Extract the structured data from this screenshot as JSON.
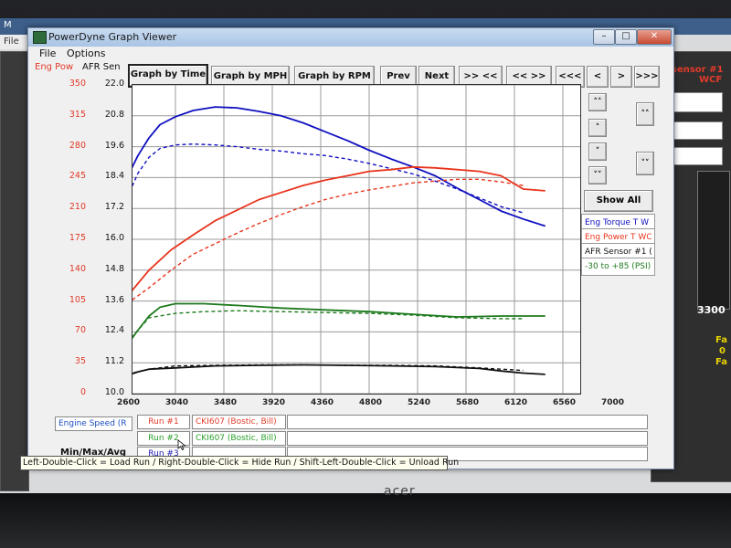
{
  "window": {
    "title": "PowerDyne Graph Viewer",
    "menu": [
      "File",
      "Options"
    ]
  },
  "background_app": {
    "title_fragment": "M",
    "menu_file": "File",
    "sensor_label": "sensor #1",
    "sensor_sub": "WCF",
    "rpm_readout": "3300",
    "fa1": "Fa",
    "fa2": "0",
    "fa3": "Fa"
  },
  "axis_headers": {
    "power": "Eng Pow",
    "afr": "AFR Sen"
  },
  "toolbar": {
    "graph_by_time": "Graph by Time",
    "graph_by_mph": "Graph by MPH",
    "graph_by_rpm": "Graph by RPM",
    "prev": "Prev",
    "next": "Next",
    "zoom_in": ">> <<",
    "zoom_out": "<< >>",
    "first": "<<<",
    "left": "<",
    "right": ">",
    "last": ">>>"
  },
  "side_buttons": {
    "up_fast": "˄˄",
    "up": "˄",
    "down": "˅",
    "down_fast": "˅˅",
    "right_up": "˄˄",
    "right_down": "˅˅",
    "show_all": "Show All"
  },
  "legend": {
    "torque": "Eng Torque T W",
    "power": "Eng Power T WC",
    "afr": "AFR Sensor #1 (",
    "boost": "-30 to +85 (PSI)"
  },
  "bottom": {
    "x_channel": "Engine Speed (R",
    "min_max": "Min/Max/Avg",
    "runs": [
      {
        "label": "Run #1",
        "name": "CKI607 (Bostic, Bill)"
      },
      {
        "label": "Run #2",
        "name": "CKI607 (Bostic, Bill)"
      },
      {
        "label": "Run #3",
        "name": ""
      }
    ]
  },
  "tooltip": "Left-Double-Click = Load Run  /  Right-Double-Click = Hide Run  /  Shift-Left-Double-Click = Unload Run",
  "brand": "acer",
  "colors": {
    "torque": "#1010c0",
    "power": "#e8341c",
    "boost": "#1e7a1e",
    "afr": "#111111",
    "power_axis": "#e23b2a",
    "run2": "#2aa02a",
    "run3": "#1b1bb0"
  },
  "chart_data": {
    "type": "line",
    "x_ticks": [
      2600,
      3040,
      3480,
      3920,
      4360,
      4800,
      5240,
      5680,
      6120,
      6560,
      7000
    ],
    "xlim": [
      2600,
      7000
    ],
    "y_left_ticks": [
      0,
      35,
      70,
      105,
      140,
      175,
      210,
      245,
      280,
      315,
      350
    ],
    "ylim_left": [
      0,
      350
    ],
    "y_afr_ticks": [
      "10.0",
      "11.2",
      "12.4",
      "13.6",
      "14.8",
      "16.0",
      "17.2",
      "18.4",
      "19.6",
      "20.8",
      "22.0"
    ],
    "ylim_afr": [
      10.0,
      22.0
    ],
    "series": [
      {
        "key": "torque_run1",
        "color": "#1010c0",
        "dash": false,
        "x": [
          2600,
          2700,
          2800,
          2900,
          3040,
          3200,
          3400,
          3600,
          3800,
          4000,
          4200,
          4400,
          4600,
          4800,
          5000,
          5200,
          5400,
          5600,
          5800,
          6000,
          6200,
          6400
        ],
        "y": [
          245,
          270,
          290,
          305,
          314,
          321,
          325,
          324,
          320,
          315,
          307,
          297,
          287,
          276,
          266,
          257,
          247,
          233,
          220,
          207,
          198,
          190
        ]
      },
      {
        "key": "torque_run2",
        "color": "#1010c0",
        "dash": true,
        "x": [
          2600,
          2700,
          2800,
          2900,
          3040,
          3200,
          3400,
          3600,
          3800,
          4000,
          4200,
          4400,
          4600,
          4800,
          5000,
          5200,
          5400,
          5600,
          5800,
          6000,
          6200
        ],
        "y": [
          222,
          250,
          268,
          278,
          282,
          283,
          282,
          280,
          277,
          275,
          272,
          270,
          266,
          261,
          255,
          249,
          241,
          232,
          222,
          212,
          205
        ]
      },
      {
        "key": "power_run1",
        "color": "#e8341c",
        "dash": false,
        "x": [
          2600,
          2800,
          3000,
          3200,
          3400,
          3600,
          3800,
          4000,
          4200,
          4400,
          4600,
          4800,
          5000,
          5200,
          5400,
          5600,
          5800,
          6000,
          6200,
          6400
        ],
        "y": [
          110,
          140,
          163,
          180,
          196,
          208,
          220,
          228,
          236,
          242,
          247,
          252,
          254,
          257,
          256,
          254,
          252,
          247,
          232,
          230
        ]
      },
      {
        "key": "power_run2",
        "color": "#e8341c",
        "dash": true,
        "x": [
          2600,
          2800,
          3000,
          3200,
          3400,
          3600,
          3800,
          4000,
          4200,
          4400,
          4600,
          4800,
          5000,
          5200,
          5400,
          5600,
          5800,
          6000,
          6200
        ],
        "y": [
          102,
          120,
          140,
          158,
          170,
          182,
          193,
          203,
          212,
          220,
          226,
          231,
          235,
          239,
          241,
          243,
          243,
          240,
          236
        ]
      },
      {
        "key": "boost_run1",
        "color": "#1e7a1e",
        "dash": false,
        "x": [
          2600,
          2700,
          2800,
          2900,
          3040,
          3300,
          3600,
          4000,
          4400,
          4800,
          5200,
          5600,
          6000,
          6400
        ],
        "y": [
          55,
          72,
          88,
          98,
          102,
          102,
          100,
          97,
          95,
          93,
          90,
          87,
          88,
          88
        ]
      },
      {
        "key": "boost_run2",
        "color": "#1e7a1e",
        "dash": true,
        "x": [
          2600,
          2800,
          3040,
          3300,
          3600,
          4000,
          4400,
          4800,
          5200,
          5600,
          6000,
          6200
        ],
        "y": [
          58,
          86,
          91,
          93,
          94,
          93,
          92,
          91,
          89,
          86,
          85,
          85
        ]
      },
      {
        "key": "afr_run1",
        "color": "#111111",
        "dash": false,
        "x": [
          2600,
          2700,
          2800,
          3040,
          3400,
          3800,
          4200,
          4600,
          5000,
          5400,
          5800,
          6000,
          6200,
          6400
        ],
        "y": [
          10.7,
          10.85,
          10.95,
          11.0,
          11.08,
          11.1,
          11.12,
          11.1,
          11.08,
          11.05,
          10.98,
          10.88,
          10.8,
          10.75
        ]
      },
      {
        "key": "afr_run2",
        "color": "#111111",
        "dash": true,
        "x": [
          2600,
          2800,
          3040,
          3400,
          3800,
          4200,
          4600,
          5000,
          5400,
          5800,
          6000,
          6200
        ],
        "y": [
          10.75,
          10.95,
          11.08,
          11.1,
          11.12,
          11.12,
          11.1,
          11.1,
          11.08,
          11.0,
          10.95,
          10.9
        ]
      }
    ]
  }
}
